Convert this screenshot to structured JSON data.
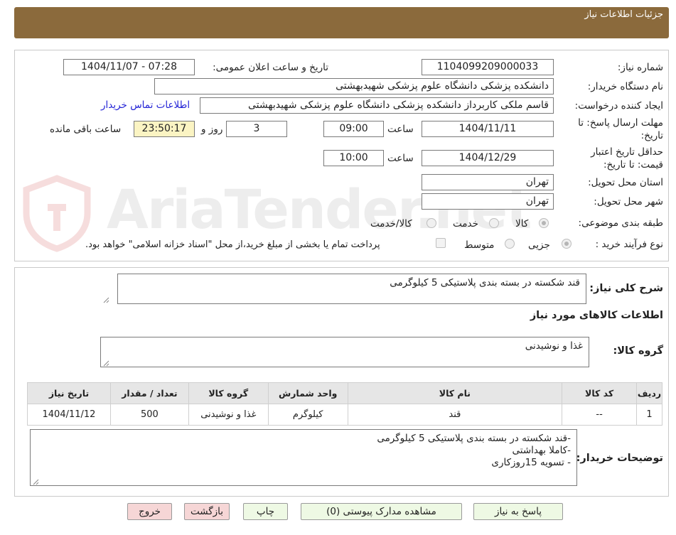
{
  "header": {
    "title": "جزئیات اطلاعات نیاز"
  },
  "watermark": {
    "brand": "AriaTender.net"
  },
  "form": {
    "need_number": {
      "label": "شماره نیاز:",
      "value": "1104099209000033"
    },
    "announce": {
      "label": "تاریخ و ساعت اعلان عمومی:",
      "value": "1404/11/07 - 07:28"
    },
    "buyer_org": {
      "label": "نام دستگاه خریدار:",
      "value": "دانشکده پزشکی دانشگاه علوم پزشکی شهیدبهشتی"
    },
    "requester": {
      "label": "ایجاد کننده درخواست:",
      "value": "قاسم ملکی کاربرداز دانشکده پزشکی دانشگاه علوم پزشکی شهیدبهشتی",
      "contact_link": "اطلاعات تماس خریدار"
    },
    "reply_deadline": {
      "label_line1": "مهلت ارسال پاسخ: تا",
      "label_line2": "تاریخ:",
      "date": "1404/11/11",
      "time_label": "ساعت",
      "time": "09:00",
      "days": "3",
      "days_label": "روز و",
      "remaining": "23:50:17",
      "remaining_label": "ساعت باقی مانده"
    },
    "price_validity": {
      "label_line1": "حداقل تاریخ اعتبار",
      "label_line2": "قیمت: تا تاریخ:",
      "date": "1404/12/29",
      "time_label": "ساعت",
      "time": "10:00"
    },
    "province": {
      "label": "استان محل تحویل:",
      "value": "تهران"
    },
    "city": {
      "label": "شهر محل تحویل:",
      "value": "تهران"
    },
    "category": {
      "label": "طبقه بندی موضوعی:",
      "options": [
        "کالا",
        "خدمت",
        "کالا/خدمت"
      ],
      "selected": "کالا"
    },
    "purchase_process": {
      "label": "نوع فرآیند خرید :",
      "options": [
        "جزیی",
        "متوسط"
      ],
      "selected": "جزیی",
      "note": "پرداخت تمام یا بخشی از مبلغ خرید،از محل \"اسناد خزانه اسلامی\" خواهد بود."
    }
  },
  "summary": {
    "label": "شرح کلی نیاز:",
    "value": "قند شکسته در بسته بندی پلاستیکی 5 کیلوگرمی"
  },
  "goods_section": {
    "title": "اطلاعات کالاهای مورد نیاز"
  },
  "goods_group": {
    "label": "گروه کالا:",
    "value": "غذا و نوشیدنی"
  },
  "table": {
    "headers": [
      "ردیف",
      "کد کالا",
      "نام کالا",
      "واحد شمارش",
      "گروه کالا",
      "تعداد / مقدار",
      "تاریخ نیاز"
    ],
    "rows": [
      [
        "1",
        "--",
        "قند",
        "کیلوگرم",
        "غذا و نوشیدنی",
        "500",
        "1404/11/12"
      ]
    ]
  },
  "buyer_notes": {
    "label": "توضیحات خریدار:",
    "lines": [
      "-قند شکسته در بسته بندی پلاستیکی 5 کیلوگرمی",
      "-کاملا بهداشتی",
      "- تسویه 15روزکاری"
    ]
  },
  "buttons": {
    "reply": "پاسخ به نیاز",
    "attachments": "مشاهده مدارک پیوستی (0)",
    "print": "چاپ",
    "back": "بازگشت",
    "exit": "خروج"
  },
  "colors": {
    "header_bg": "#8b6a3c",
    "link": "#2323d6",
    "highlight": "#fbf4c3",
    "button_green": "#eef9e4",
    "button_pink": "#f6d6d6"
  }
}
